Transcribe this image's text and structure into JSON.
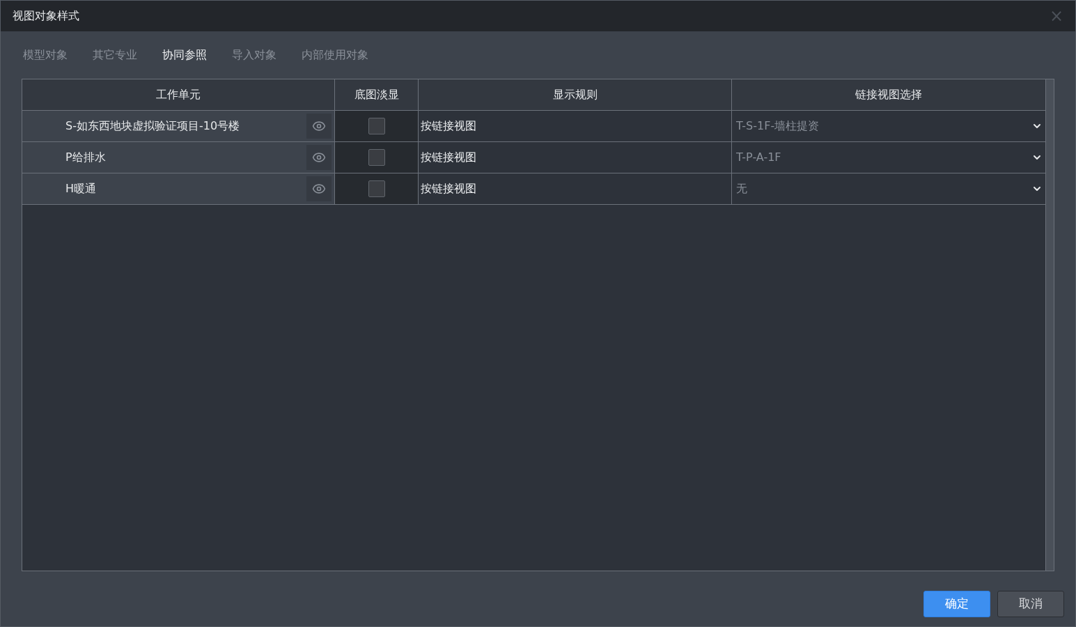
{
  "window": {
    "title": "视图对象样式",
    "close": "×"
  },
  "tabs": [
    {
      "label": "模型对象",
      "selected": false
    },
    {
      "label": "其它专业",
      "selected": false
    },
    {
      "label": "协同参照",
      "selected": true
    },
    {
      "label": "导入对象",
      "selected": false
    },
    {
      "label": "内部使用对象",
      "selected": false
    }
  ],
  "table": {
    "columns": [
      "工作单元",
      "底图淡显",
      "显示规则",
      "链接视图选择"
    ],
    "rows": [
      {
        "work_unit": "S-如东西地块虚拟验证项目-10号楼",
        "faded": false,
        "rule": "按链接视图",
        "link_view": "T-S-1F-墙柱提资"
      },
      {
        "work_unit": "P给排水",
        "faded": false,
        "rule": "按链接视图",
        "link_view": "T-P-A-1F"
      },
      {
        "work_unit": "H暖通",
        "faded": false,
        "rule": "按链接视图",
        "link_view": "无"
      }
    ]
  },
  "buttons": [
    {
      "label": "确定",
      "kind": "primary"
    },
    {
      "label": "取消",
      "kind": "secondary"
    }
  ]
}
